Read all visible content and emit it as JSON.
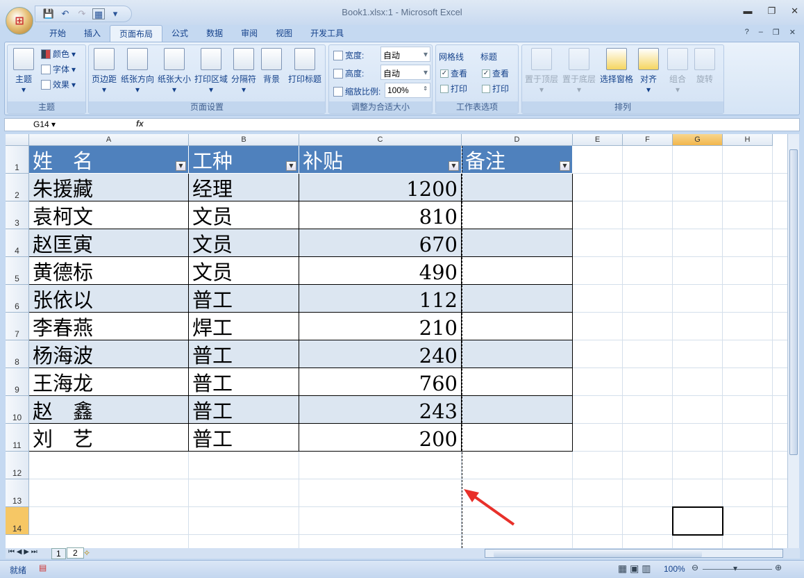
{
  "window": {
    "title": "Book1.xlsx:1 - Microsoft Excel",
    "minimize": "▬",
    "maximize": "❐",
    "close": "✕"
  },
  "qat": {
    "save": "💾",
    "undo": "↶",
    "redo": "↷",
    "more": "▾"
  },
  "tabs": [
    "开始",
    "插入",
    "页面布局",
    "公式",
    "数据",
    "审阅",
    "视图",
    "开发工具"
  ],
  "ribbon": {
    "theme": {
      "label": "主题",
      "big": "主题",
      "colors": "颜色",
      "fonts": "字体",
      "effects": "效果"
    },
    "page_setup": {
      "label": "页面设置",
      "buttons": [
        "页边距",
        "纸张方向",
        "纸张大小",
        "打印区域",
        "分隔符",
        "背景",
        "打印标题"
      ]
    },
    "scale": {
      "label": "调整为合适大小",
      "width_label": "宽度:",
      "width_value": "自动",
      "height_label": "高度:",
      "height_value": "自动",
      "scale_label": "缩放比例:",
      "scale_value": "100%"
    },
    "sheet_options": {
      "label": "工作表选项",
      "gridlines": "网格线",
      "headings": "标题",
      "view": "查看",
      "print": "打印",
      "gridlines_view": true,
      "gridlines_print": false,
      "headings_view": true,
      "headings_print": false
    },
    "arrange": {
      "label": "排列",
      "buttons": [
        "置于顶层",
        "置于底层",
        "选择窗格",
        "对齐",
        "组合",
        "旋转"
      ]
    }
  },
  "formula_bar": {
    "name_box": "G14",
    "fx": "fx",
    "value": ""
  },
  "columns": [
    "A",
    "B",
    "C",
    "D",
    "E",
    "F",
    "G",
    "H"
  ],
  "rows": [
    "1",
    "2",
    "3",
    "4",
    "5",
    "6",
    "7",
    "8",
    "9",
    "10",
    "11",
    "12",
    "13",
    "14"
  ],
  "table": {
    "headers": [
      "姓　名",
      "工种",
      "补贴",
      "备注"
    ],
    "data": [
      [
        "朱援藏",
        "经理",
        "1200",
        ""
      ],
      [
        "袁柯文",
        "文员",
        "810",
        ""
      ],
      [
        "赵匡寅",
        "文员",
        "670",
        ""
      ],
      [
        "黄德标",
        "文员",
        "490",
        ""
      ],
      [
        "张依以",
        "普工",
        "112",
        ""
      ],
      [
        "李春燕",
        "焊工",
        "210",
        ""
      ],
      [
        "杨海波",
        "普工",
        "240",
        ""
      ],
      [
        "王海龙",
        "普工",
        "760",
        ""
      ],
      [
        "赵　鑫",
        "普工",
        "243",
        ""
      ],
      [
        "刘　艺",
        "普工",
        "200",
        ""
      ]
    ]
  },
  "sheets": [
    "1",
    "2"
  ],
  "status": {
    "ready": "就绪",
    "zoom": "100%"
  },
  "colors": {
    "header": "#4f81bd",
    "band": "#dce6f1",
    "arrow": "#e8302a"
  }
}
